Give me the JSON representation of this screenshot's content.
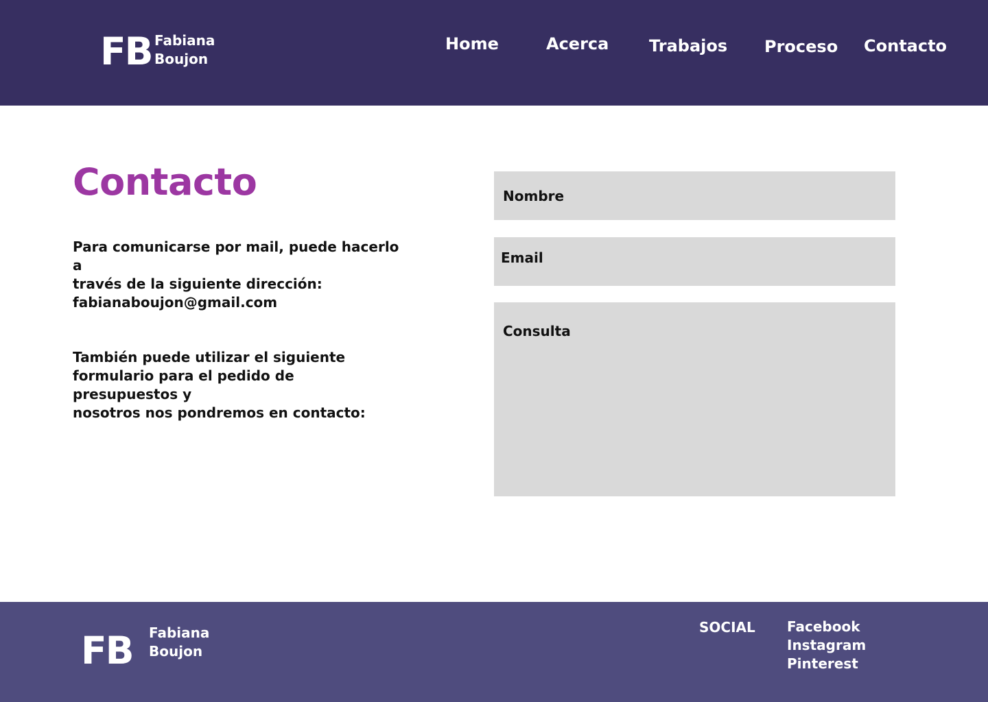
{
  "brand": {
    "mark": "FB",
    "first_name": "Fabiana",
    "last_name": "Boujon"
  },
  "nav": {
    "home": "Home",
    "acerca": "Acerca",
    "trabajos": "Trabajos",
    "proceso": "Proceso",
    "contacto": "Contacto"
  },
  "contact": {
    "title": "Contacto",
    "intro_line1": "Para comunicarse por mail, puede hacerlo a",
    "intro_line2": "través de la siguiente dirección:",
    "email": "fabianaboujon@gmail.com",
    "form_intro_line1": "También puede utilizar el siguiente",
    "form_intro_line2": "formulario para el pedido de presupuestos y",
    "form_intro_line3": "nosotros nos pondremos en contacto:"
  },
  "form": {
    "nombre_placeholder": "Nombre",
    "email_placeholder": "Email",
    "consulta_placeholder": "Consulta"
  },
  "footer": {
    "social_label": "SOCIAL",
    "links": [
      "Facebook",
      "Instagram",
      "Pinterest"
    ]
  },
  "colors": {
    "header_bg": "#372f61",
    "footer_bg": "#4f4c7e",
    "title_accent": "#9c37a2",
    "field_bg": "#d9d9d9"
  }
}
